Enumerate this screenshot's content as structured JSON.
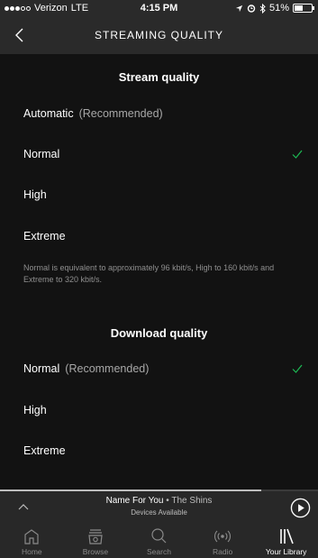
{
  "status_bar": {
    "carrier": "Verizon",
    "network": "LTE",
    "time": "4:15 PM",
    "battery": "51%",
    "battery_level": 0.51
  },
  "nav": {
    "title": "STREAMING QUALITY",
    "back_icon": "chevron-left-icon"
  },
  "stream_quality": {
    "header": "Stream quality",
    "options": [
      {
        "label": "Automatic",
        "note": "(Recommended)",
        "selected": false
      },
      {
        "label": "Normal",
        "note": "",
        "selected": true
      },
      {
        "label": "High",
        "note": "",
        "selected": false
      },
      {
        "label": "Extreme",
        "note": "",
        "selected": false
      }
    ],
    "description": "Normal is equivalent to approximately 96 kbit/s, High to 160 kbit/s and Extreme to 320 kbit/s."
  },
  "download_quality": {
    "header": "Download quality",
    "options": [
      {
        "label": "Normal",
        "note": "(Recommended)",
        "selected": true
      },
      {
        "label": "High",
        "note": "",
        "selected": false
      },
      {
        "label": "Extreme",
        "note": "",
        "selected": false
      }
    ]
  },
  "player": {
    "track": "Name For You",
    "separator": " • ",
    "artist": "The Shins",
    "devices": "Devices Available"
  },
  "tabs": [
    {
      "label": "Home",
      "icon": "home-icon",
      "active": false
    },
    {
      "label": "Browse",
      "icon": "browse-icon",
      "active": false
    },
    {
      "label": "Search",
      "icon": "search-icon",
      "active": false
    },
    {
      "label": "Radio",
      "icon": "radio-icon",
      "active": false
    },
    {
      "label": "Your Library",
      "icon": "library-icon",
      "active": true
    }
  ],
  "colors": {
    "accent": "#1db954",
    "background": "#121212",
    "bar": "#282828"
  }
}
